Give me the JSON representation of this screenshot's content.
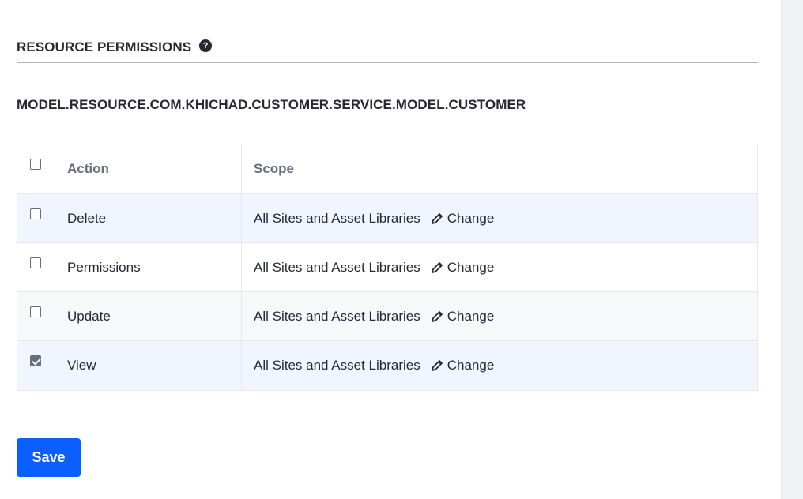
{
  "section": {
    "title": "RESOURCE PERMISSIONS",
    "help_icon": "?"
  },
  "resource": {
    "name": "MODEL.RESOURCE.COM.KHICHAD.CUSTOMER.SERVICE.MODEL.CUSTOMER"
  },
  "table": {
    "headers": {
      "action": "Action",
      "scope": "Scope"
    },
    "rows": [
      {
        "action": "Delete",
        "scope": "All Sites and Asset Libraries",
        "change": "Change",
        "checked": false
      },
      {
        "action": "Permissions",
        "scope": "All Sites and Asset Libraries",
        "change": "Change",
        "checked": false
      },
      {
        "action": "Update",
        "scope": "All Sites and Asset Libraries",
        "change": "Change",
        "checked": false
      },
      {
        "action": "View",
        "scope": "All Sites and Asset Libraries",
        "change": "Change",
        "checked": true
      }
    ]
  },
  "footer": {
    "save_label": "Save"
  },
  "colors": {
    "primary": "#0b5fff",
    "highlight_row": "#f0f5ff",
    "alt_row": "#f7f8f9",
    "text": "#272833",
    "muted": "#6b6c7e"
  },
  "icons": {
    "help": "help-icon",
    "pencil": "pencil-icon"
  }
}
